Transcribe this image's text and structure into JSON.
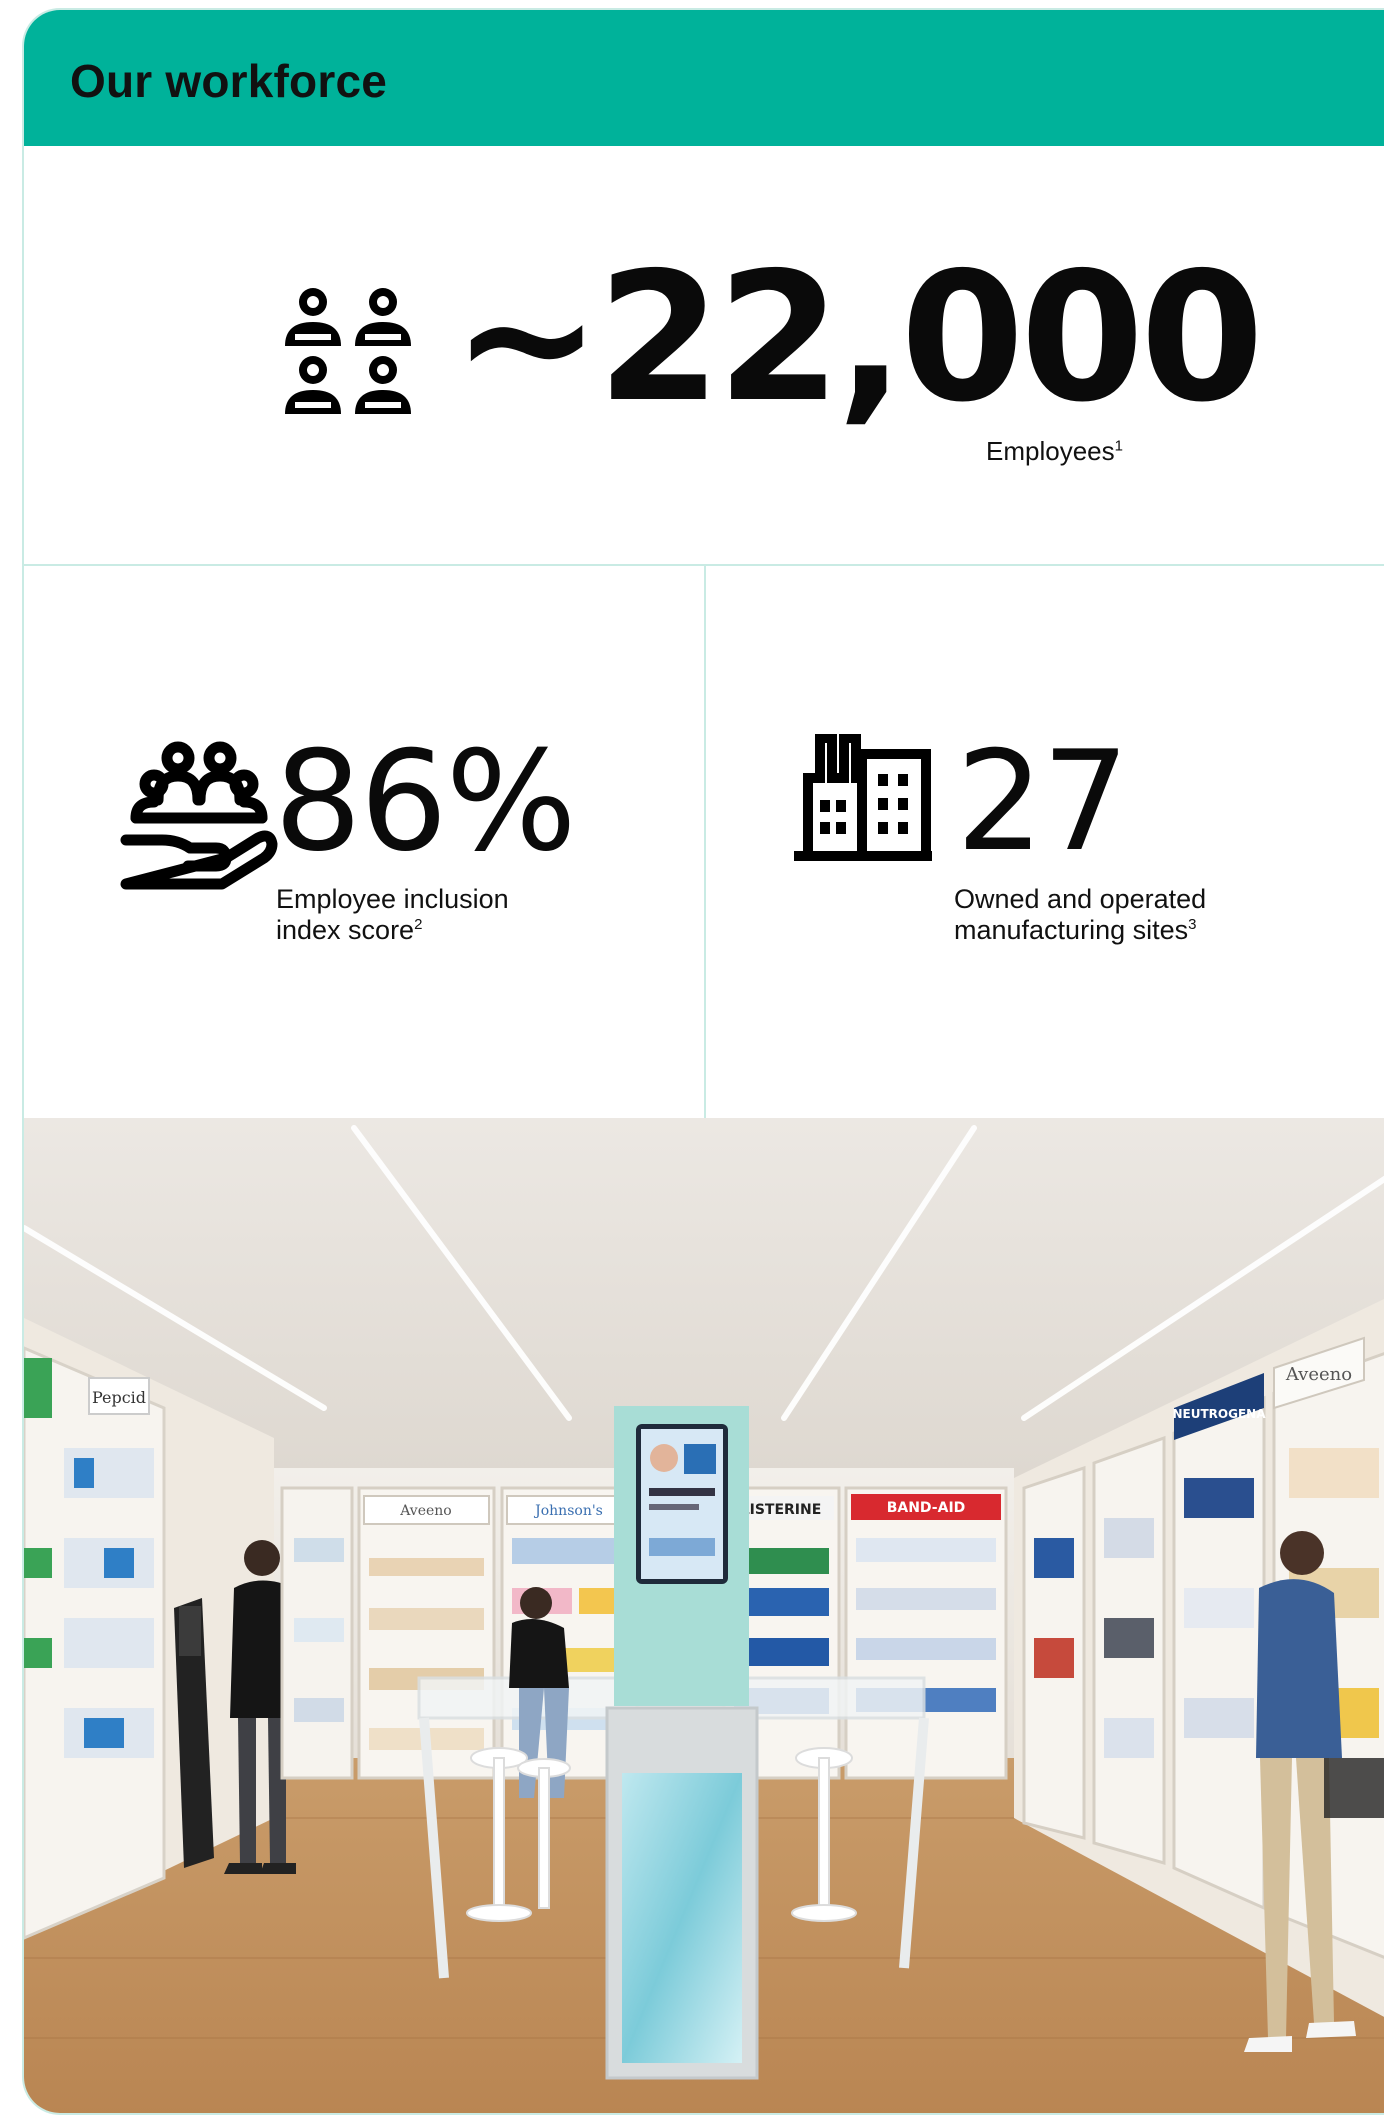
{
  "header": {
    "title": "Our workforce"
  },
  "hero": {
    "value": "~22,000",
    "label": "Employees",
    "footnote": "1",
    "icon": "people-group-icon"
  },
  "inclusion": {
    "value": "86%",
    "label_line1": "Employee inclusion",
    "label_line2": "index score",
    "footnote": "2",
    "icon": "hand-holding-people-icon"
  },
  "manufacturing": {
    "value": "27",
    "label_line1": "Owned and operated",
    "label_line2": "manufacturing sites",
    "footnote": "3",
    "icon": "factory-icon"
  },
  "photo_brand_signs": {
    "left_shelf": "Pepcid",
    "center_left": "Aveeno",
    "center": "Johnson's",
    "listerine": "LISTERINE",
    "bandaid": "BAND-AID",
    "right_top": "Aveeno",
    "right_top2": "NEUTROGENA"
  },
  "colors": {
    "accent": "#00b29a",
    "border": "#c9ebe4",
    "text": "#111111"
  }
}
